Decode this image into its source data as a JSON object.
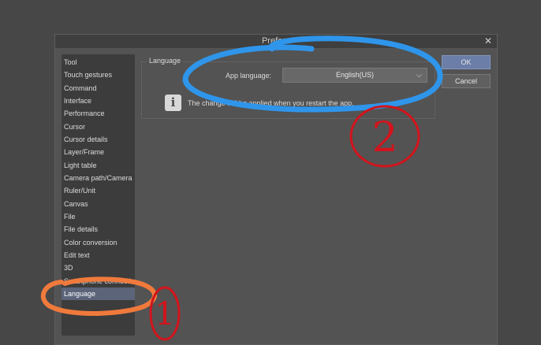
{
  "dialog": {
    "title": "Prefere",
    "close_glyph": "✕"
  },
  "sidebar": {
    "items": [
      {
        "label": "Tool"
      },
      {
        "label": "Touch gestures"
      },
      {
        "label": "Command"
      },
      {
        "label": "Interface"
      },
      {
        "label": "Performance"
      },
      {
        "label": "Cursor"
      },
      {
        "label": "Cursor details"
      },
      {
        "label": "Layer/Frame"
      },
      {
        "label": "Light table"
      },
      {
        "label": "Camera path/Camera"
      },
      {
        "label": "Ruler/Unit"
      },
      {
        "label": "Canvas"
      },
      {
        "label": "File"
      },
      {
        "label": "File details"
      },
      {
        "label": "Color conversion"
      },
      {
        "label": "Edit text"
      },
      {
        "label": "3D"
      },
      {
        "label": "Smartphone connection"
      },
      {
        "label": "Language",
        "selected": true
      }
    ]
  },
  "language_group": {
    "title": "Language",
    "app_language_label": "App language:",
    "app_language_value": "English(US)",
    "info_text": "The change will be applied when you restart the app."
  },
  "buttons": {
    "ok_label": "OK",
    "cancel_label": "Cancel"
  },
  "icons": {
    "info": "i",
    "chevron": "⌵"
  },
  "annotations": {
    "marker_1": "1",
    "marker_2": "2",
    "colors": {
      "orange": "#f07a3c",
      "blue": "#2f95ea",
      "red": "#d2141c"
    }
  }
}
